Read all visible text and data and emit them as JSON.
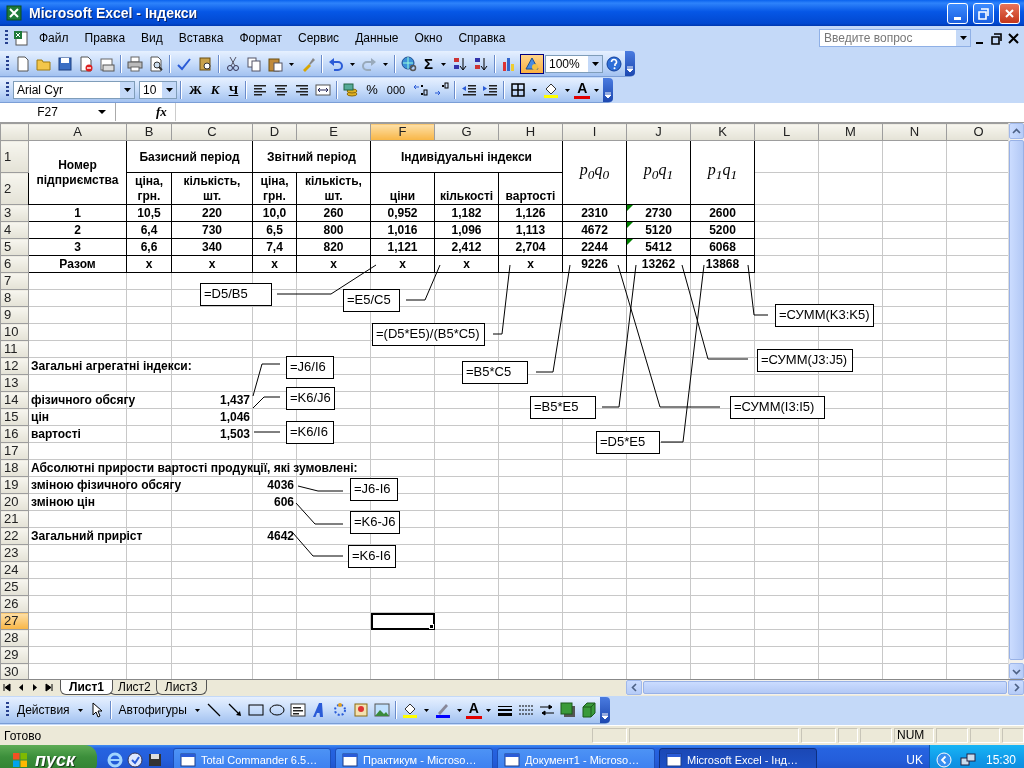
{
  "window": {
    "title": "Microsoft Excel - Індекси"
  },
  "menu": {
    "items": [
      "Файл",
      "Правка",
      "Вид",
      "Вставка",
      "Формат",
      "Сервис",
      "Данные",
      "Окно",
      "Справка"
    ],
    "help_placeholder": "Введите вопрос"
  },
  "standard_toolbar": {
    "autosum": "Σ",
    "zoom": "100%",
    "drawing_pressed": true
  },
  "formatting_toolbar": {
    "font": "Arial Cyr",
    "size": "10",
    "bold": "Ж",
    "italic": "К",
    "underline": "Ч",
    "percent": "%",
    "thousands": "000",
    "font_color": "A"
  },
  "formula_bar": {
    "name_box": "F27",
    "fx": "fx"
  },
  "sheet": {
    "columns": [
      {
        "label": "A",
        "selected": false
      },
      {
        "label": "B",
        "selected": false
      },
      {
        "label": "C",
        "selected": false
      },
      {
        "label": "D",
        "selected": false
      },
      {
        "label": "E",
        "selected": false
      },
      {
        "label": "F",
        "selected": true
      },
      {
        "label": "G",
        "selected": false
      },
      {
        "label": "H",
        "selected": false
      },
      {
        "label": "I",
        "selected": false
      },
      {
        "label": "J",
        "selected": false
      },
      {
        "label": "K",
        "selected": false
      },
      {
        "label": "L",
        "selected": false
      },
      {
        "label": "M",
        "selected": false
      },
      {
        "label": "N",
        "selected": false
      },
      {
        "label": "O",
        "selected": false
      }
    ],
    "rows": [
      {
        "label": "1",
        "selected": false
      },
      {
        "label": "2",
        "selected": false
      },
      {
        "label": "3",
        "selected": false
      },
      {
        "label": "4",
        "selected": false
      },
      {
        "label": "5",
        "selected": false
      },
      {
        "label": "6",
        "selected": false
      },
      {
        "label": "7",
        "selected": false
      },
      {
        "label": "8",
        "selected": false
      },
      {
        "label": "9",
        "selected": false
      },
      {
        "label": "10",
        "selected": false
      },
      {
        "label": "11",
        "selected": false
      },
      {
        "label": "12",
        "selected": false
      },
      {
        "label": "13",
        "selected": false
      },
      {
        "label": "14",
        "selected": false
      },
      {
        "label": "15",
        "selected": false
      },
      {
        "label": "16",
        "selected": false
      },
      {
        "label": "17",
        "selected": false
      },
      {
        "label": "18",
        "selected": false
      },
      {
        "label": "19",
        "selected": false
      },
      {
        "label": "20",
        "selected": false
      },
      {
        "label": "21",
        "selected": false
      },
      {
        "label": "22",
        "selected": false
      },
      {
        "label": "23",
        "selected": false
      },
      {
        "label": "24",
        "selected": false
      },
      {
        "label": "25",
        "selected": false
      },
      {
        "label": "26",
        "selected": false
      },
      {
        "label": "27",
        "selected": true
      },
      {
        "label": "28",
        "selected": false
      },
      {
        "label": "29",
        "selected": false
      },
      {
        "label": "30",
        "selected": false
      }
    ],
    "header": {
      "number_label": "Номер підприємства",
      "groups": [
        {
          "title": "Базисний період",
          "columns": [
            "ціна, грн.",
            "кількість, шт."
          ]
        },
        {
          "title": "Звітний період",
          "columns": [
            "ціна, грн.",
            "кількість, шт."
          ]
        },
        {
          "title": "Індивідуальні індекси",
          "columns": [
            "ціни",
            "кількості",
            "вартості"
          ]
        }
      ],
      "products": [
        "p$_{0}$q$_{0}$",
        "p$_{0}$q$_{1}$",
        "p$_{1}$q$_{1}$"
      ]
    },
    "data_rows": [
      {
        "cells": [
          "1",
          "10,5",
          "220",
          "10,0",
          "260",
          "0,952",
          "1,182",
          "1,126",
          "2310",
          "2730",
          "2600"
        ],
        "error_indicator": true
      },
      {
        "cells": [
          "2",
          "6,4",
          "730",
          "6,5",
          "800",
          "1,016",
          "1,096",
          "1,113",
          "4672",
          "5120",
          "5200"
        ],
        "error_indicator": true
      },
      {
        "cells": [
          "3",
          "6,6",
          "340",
          "7,4",
          "820",
          "1,121",
          "2,412",
          "2,704",
          "2244",
          "5412",
          "6068"
        ],
        "error_indicator": true
      }
    ],
    "total_row": [
      "Разом",
      "x",
      "x",
      "x",
      "x",
      "x",
      "x",
      "x",
      "9226",
      "13262",
      "13868"
    ],
    "summary": [
      {
        "label": "Загальні агрегатні індекси:"
      },
      {
        "label": "фізичного обсягу",
        "value": "1,437"
      },
      {
        "label": "цін",
        "value": "1,046"
      },
      {
        "label": "вартості",
        "value": "1,503"
      },
      {
        "label": "Абсолютні прирости вартості продукції, які зумовлені:"
      },
      {
        "label": "зміною фізичного обсягу",
        "value": "4036"
      },
      {
        "label": "зміною цін",
        "value": "606"
      },
      {
        "label": "Загальний приріст",
        "value": "4642"
      }
    ],
    "callouts": [
      {
        "formula": "=D5/B5"
      },
      {
        "formula": "=E5/C5"
      },
      {
        "formula": "=(D5*E5)/(B5*C5)"
      },
      {
        "formula": "=B5*C5"
      },
      {
        "formula": "=B5*E5"
      },
      {
        "formula": "=D5*E5"
      },
      {
        "formula": "=СУММ(K3:K5)"
      },
      {
        "formula": "=СУММ(J3:J5)"
      },
      {
        "formula": "=СУММ(I3:I5)"
      },
      {
        "formula": "=J6/I6"
      },
      {
        "formula": "=K6/J6"
      },
      {
        "formula": "=K6/I6"
      },
      {
        "formula": "=J6-I6"
      },
      {
        "formula": "=K6-J6"
      },
      {
        "formula": "=K6-I6"
      }
    ]
  },
  "sheet_tabs": [
    {
      "label": "Лист1",
      "selected": true
    },
    {
      "label": "Лист2",
      "selected": false
    },
    {
      "label": "Лист3",
      "selected": false
    }
  ],
  "drawing_toolbar": {
    "actions": "Действия",
    "autoshapes": "Автофигуры",
    "font_color": "A"
  },
  "status_bar": {
    "status": "Готово",
    "num": "NUM"
  },
  "taskbar": {
    "start": "пуск",
    "tasks": [
      {
        "label": "Total Commander 6.5…",
        "selected": false
      },
      {
        "label": "Практикум - Microso…",
        "selected": false
      },
      {
        "label": "Документ1 - Microso…",
        "selected": false
      },
      {
        "label": "Microsoft Excel - Інд…",
        "selected": true
      }
    ],
    "language": "UK",
    "clock": "15:30"
  }
}
